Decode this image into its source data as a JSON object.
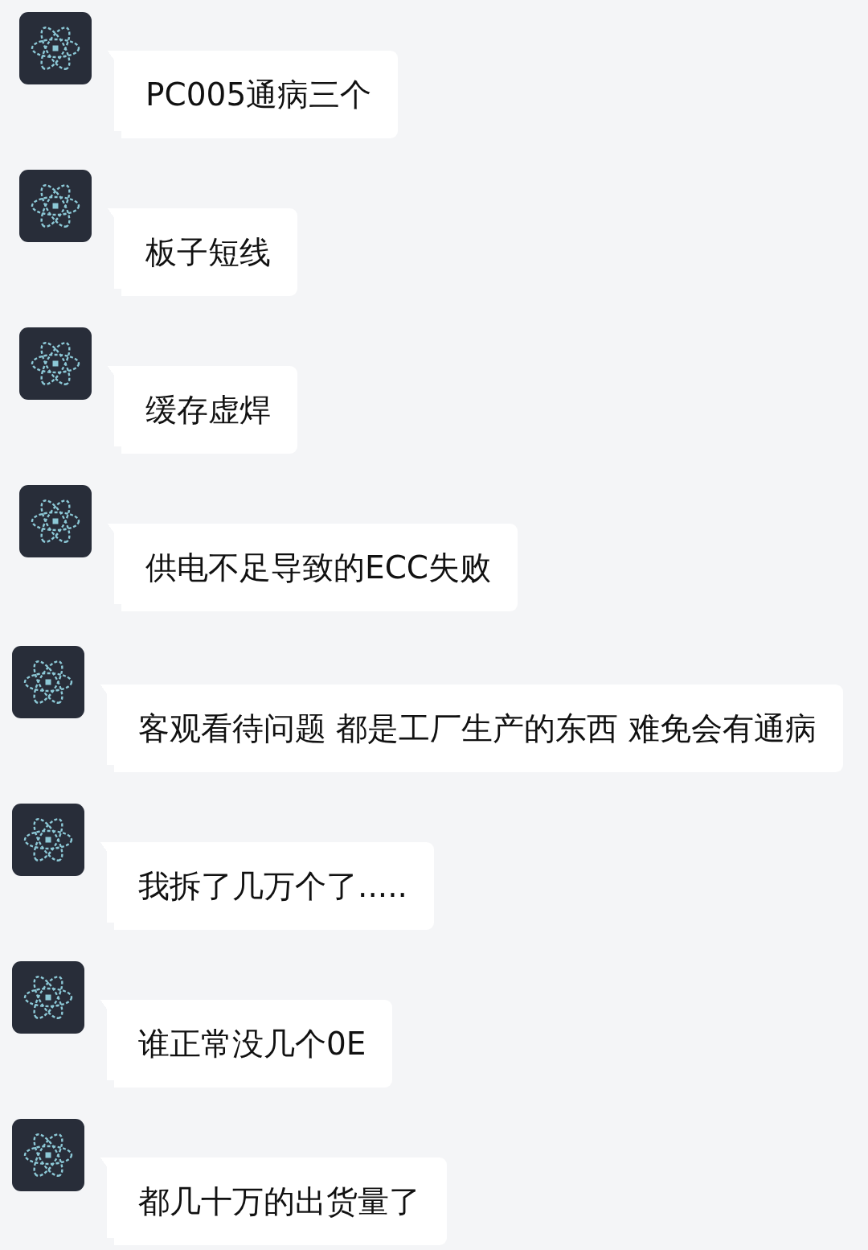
{
  "messages": [
    {
      "text": "PC005通病三个"
    },
    {
      "text": "板子短线"
    },
    {
      "text": "缓存虚焊"
    },
    {
      "text": "供电不足导致的ECC失败"
    },
    {
      "text": "客观看待问题 都是工厂生产的东西 难免会有通病"
    },
    {
      "text": "我拆了几万个了....."
    },
    {
      "text": "谁正常没几个0E"
    },
    {
      "text": "都几十万的出货量了"
    }
  ]
}
